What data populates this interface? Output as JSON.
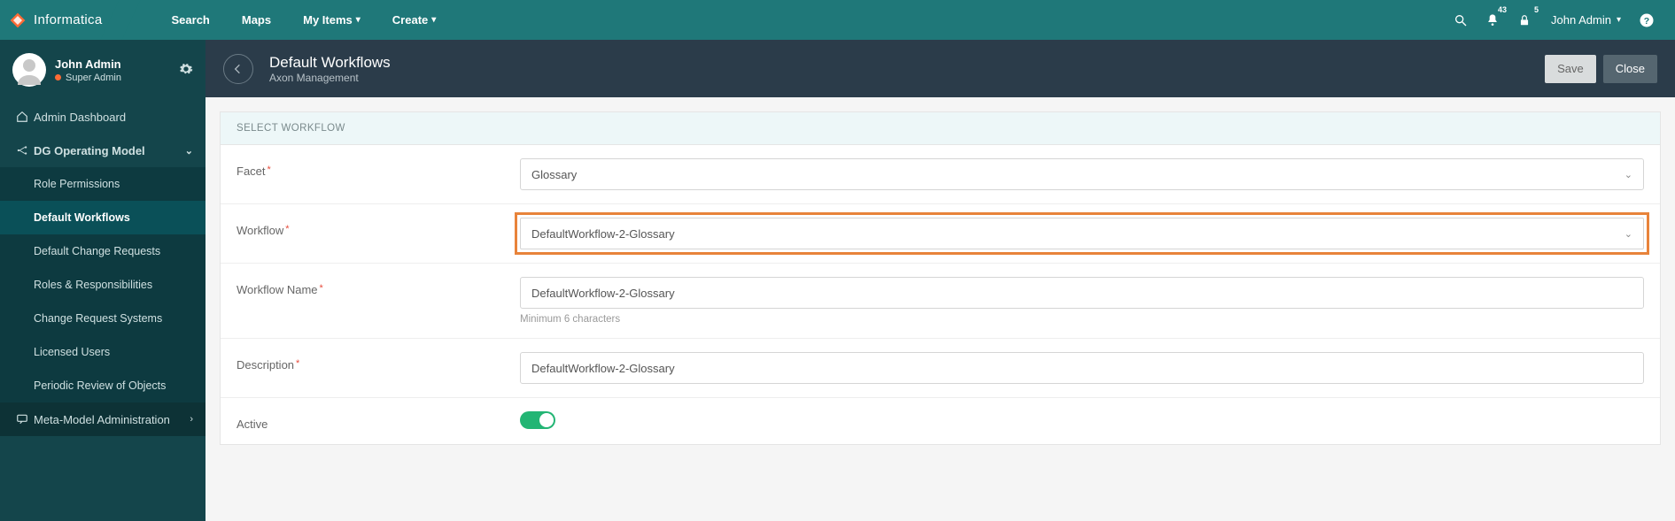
{
  "brand": "Informatica",
  "nav": {
    "search": "Search",
    "maps": "Maps",
    "myitems": "My Items",
    "create": "Create"
  },
  "notifications": {
    "bell_count": "43",
    "alert_count": "5"
  },
  "current_user": {
    "display": "John Admin"
  },
  "sidebar": {
    "user": {
      "name": "John Admin",
      "role": "Super Admin"
    },
    "items": {
      "dashboard": "Admin Dashboard",
      "dg": "DG Operating Model",
      "role_perm": "Role Permissions",
      "default_workflows": "Default Workflows",
      "default_cr": "Default Change Requests",
      "roles_resp": "Roles & Responsibilities",
      "cr_systems": "Change Request Systems",
      "licensed": "Licensed Users",
      "periodic": "Periodic Review of Objects",
      "metamodel": "Meta-Model Administration"
    }
  },
  "header": {
    "title": "Default Workflows",
    "subtitle": "Axon Management",
    "save": "Save",
    "close": "Close"
  },
  "panel": {
    "title": "SELECT WORKFLOW",
    "facet": {
      "label": "Facet",
      "value": "Glossary"
    },
    "workflow": {
      "label": "Workflow",
      "value": "DefaultWorkflow-2-Glossary"
    },
    "workflow_name": {
      "label": "Workflow Name",
      "value": "DefaultWorkflow-2-Glossary",
      "hint": "Minimum 6 characters"
    },
    "description": {
      "label": "Description",
      "value": "DefaultWorkflow-2-Glossary"
    },
    "active": {
      "label": "Active"
    }
  }
}
